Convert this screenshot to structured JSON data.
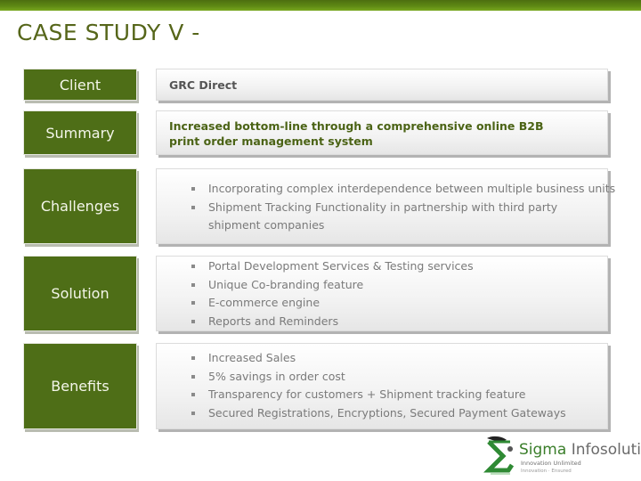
{
  "slide": {
    "title": "CASE STUDY V -"
  },
  "rows": {
    "client": {
      "label": "Client",
      "value": "GRC Direct"
    },
    "summary": {
      "label": "Summary",
      "value": "Increased bottom-line through a comprehensive online B2B print order management system"
    },
    "challenges": {
      "label": "Challenges",
      "items": [
        "Incorporating complex interdependence between multiple business units",
        "Shipment Tracking Functionality in partnership with third party shipment companies"
      ]
    },
    "solution": {
      "label": "Solution",
      "items": [
        "Portal Development Services & Testing services",
        "Unique Co-branding feature",
        "E-commerce engine",
        "Reports and Reminders"
      ]
    },
    "benefits": {
      "label": "Benefits",
      "items": [
        "Increased Sales",
        "5% savings in order cost",
        "Transparency for customers + Shipment tracking feature",
        "Secured Registrations, Encryptions, Secured Payment Gateways"
      ]
    }
  },
  "logo": {
    "brand_prefix": "Sigma",
    "brand_suffix": " Infosolutions",
    "tagline": "Innovation Unlimited",
    "subtagline": "Innovation · Ensured",
    "icon": "sigma-icon"
  },
  "colors": {
    "accent_green": "#4e6e17",
    "title_green": "#56661a",
    "bullet_text": "#7a7a7a"
  }
}
